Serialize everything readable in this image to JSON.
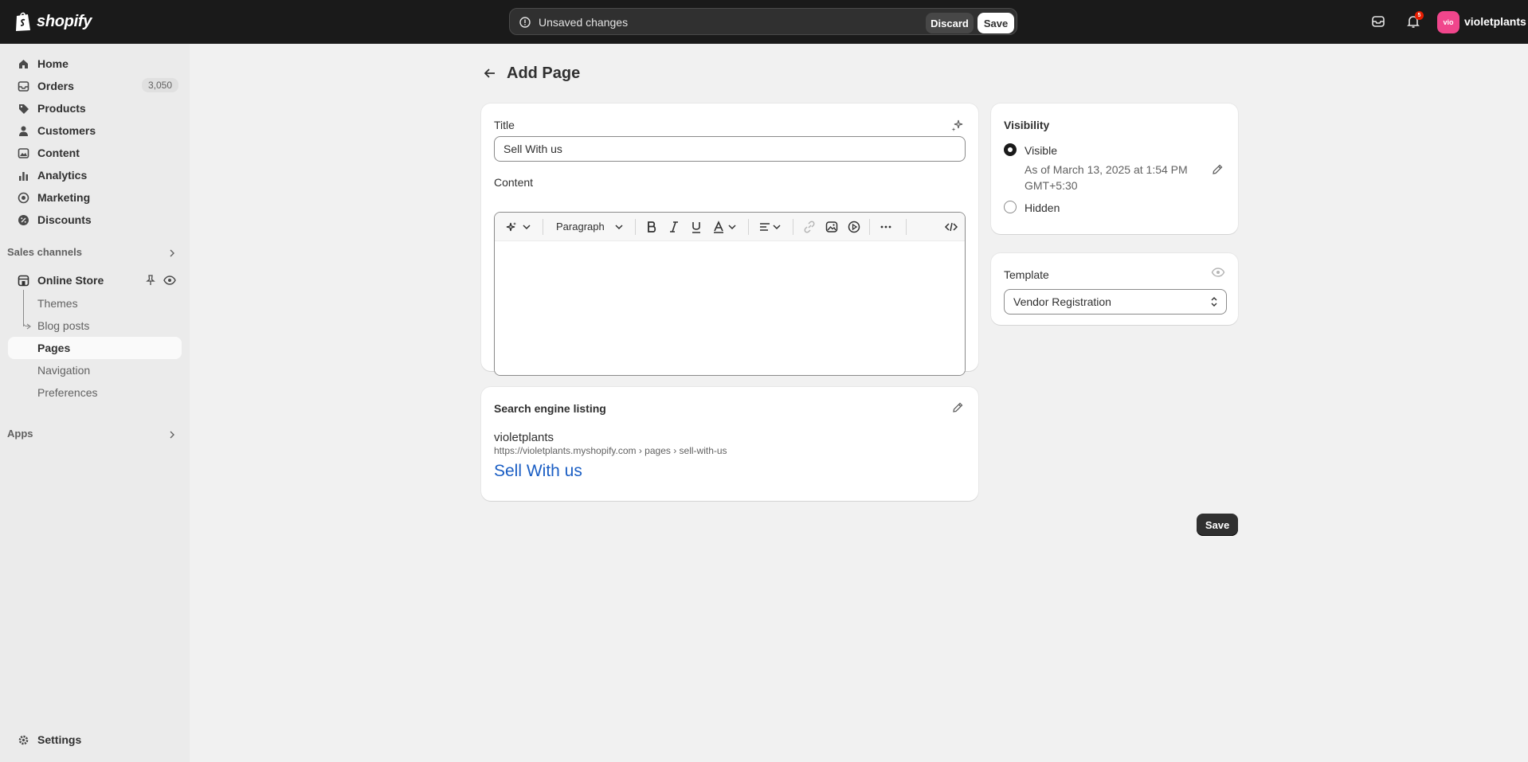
{
  "topbar": {
    "logo_text": "shopify",
    "unsaved_message": "Unsaved changes",
    "discard_label": "Discard",
    "save_label": "Save",
    "notification_count": "5",
    "store_avatar": "vio",
    "store_name": "violetplants"
  },
  "sidebar": {
    "items": [
      {
        "label": "Home",
        "icon": "home-icon"
      },
      {
        "label": "Orders",
        "icon": "inbox-icon",
        "count": "3,050"
      },
      {
        "label": "Products",
        "icon": "tag-icon"
      },
      {
        "label": "Customers",
        "icon": "person-icon"
      },
      {
        "label": "Content",
        "icon": "image-icon"
      },
      {
        "label": "Analytics",
        "icon": "bar-chart-icon"
      },
      {
        "label": "Marketing",
        "icon": "target-icon"
      },
      {
        "label": "Discounts",
        "icon": "discount-icon"
      }
    ],
    "sales_channels_label": "Sales channels",
    "online_store_label": "Online Store",
    "online_store_sub": [
      {
        "label": "Themes"
      },
      {
        "label": "Blog posts"
      },
      {
        "label": "Pages"
      },
      {
        "label": "Navigation"
      },
      {
        "label": "Preferences"
      }
    ],
    "apps_label": "Apps",
    "settings_label": "Settings"
  },
  "page": {
    "title": "Add Page",
    "title_field_label": "Title",
    "title_field_value": "Sell With us",
    "content_label": "Content",
    "paragraph_label": "Paragraph",
    "save_label": "Save"
  },
  "visibility": {
    "heading": "Visibility",
    "visible_label": "Visible",
    "visible_date_line1": "As of March 13, 2025 at 1:54 PM",
    "visible_date_line2": "GMT+5:30",
    "hidden_label": "Hidden"
  },
  "template": {
    "heading": "Template",
    "selected": "Vendor Registration"
  },
  "seo": {
    "heading": "Search engine listing",
    "store_name": "violetplants",
    "url": "https://violetplants.myshopify.com › pages › sell-with-us",
    "page_title": "Sell With us"
  }
}
